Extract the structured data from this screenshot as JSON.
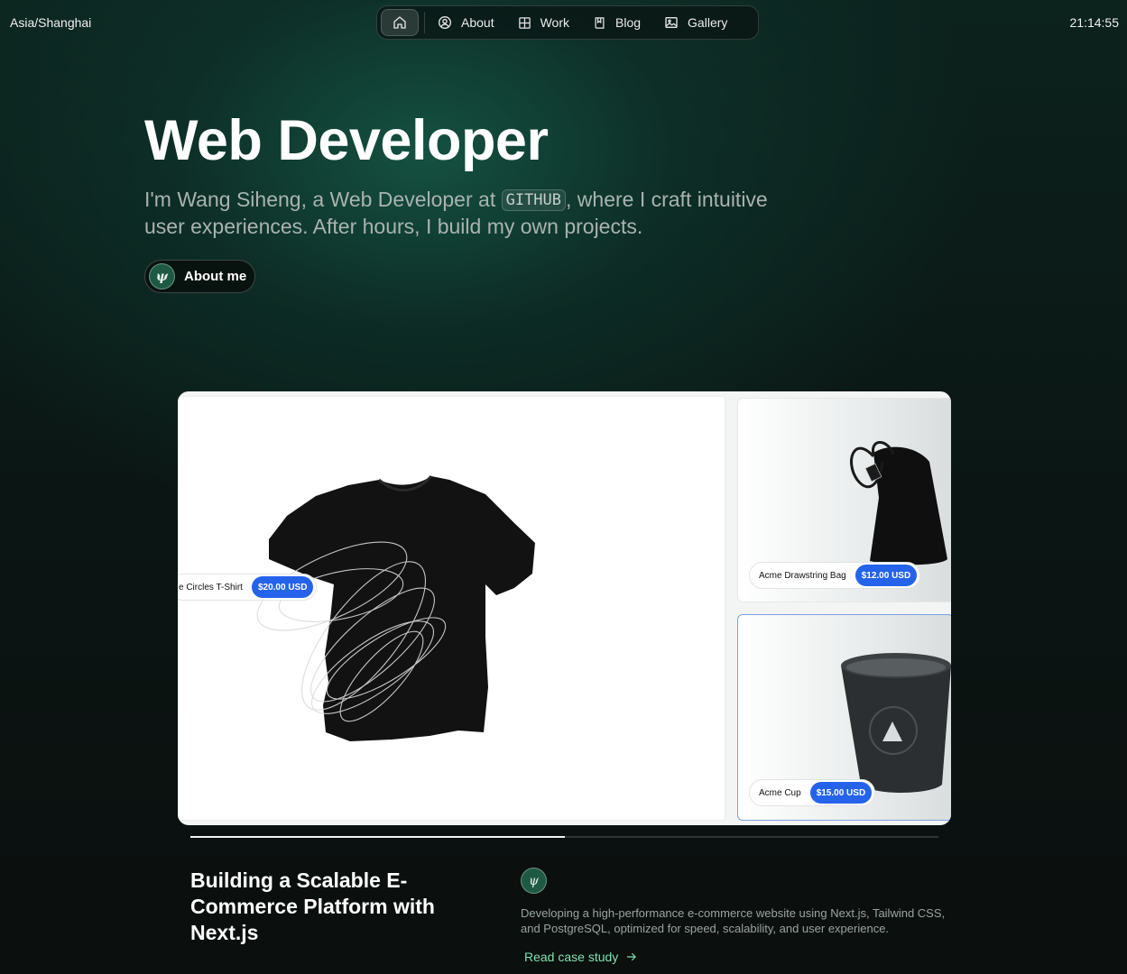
{
  "topbar": {
    "timezone": "Asia/Shanghai",
    "time": "21:14:55"
  },
  "nav": {
    "items": [
      {
        "label": "About",
        "icon": "user-circle-icon"
      },
      {
        "label": "Work",
        "icon": "grid-icon"
      },
      {
        "label": "Blog",
        "icon": "book-icon"
      },
      {
        "label": "Gallery",
        "icon": "image-icon"
      }
    ],
    "home_icon": "home-icon"
  },
  "hero": {
    "title": "Web Developer",
    "intro_before": "I'm Wang Siheng, a Web Developer at ",
    "company": "GITHUB",
    "intro_after": ", where I craft intuitive user experiences. After hours, I build my own projects.",
    "about_button": "About me",
    "avatar_initials": "ψ"
  },
  "showcase": {
    "products": [
      {
        "name": "e Circles T-Shirt",
        "price": "$20.00 USD"
      },
      {
        "name": "Acme Drawstring Bag",
        "price": "$12.00 USD"
      },
      {
        "name": "Acme Cup",
        "price": "$15.00 USD"
      }
    ],
    "progress": 0.5
  },
  "project": {
    "title": "Building a Scalable E-Commerce Platform with Next.js",
    "description": "Developing a high-performance e-commerce website using Next.js, Tailwind CSS, and PostgreSQL, optimized for speed, scalability, and user experience.",
    "link_label": "Read case study"
  },
  "colors": {
    "accent_green": "#7fe3b3",
    "price_pill": "#2563eb",
    "background": "#0b1513"
  }
}
